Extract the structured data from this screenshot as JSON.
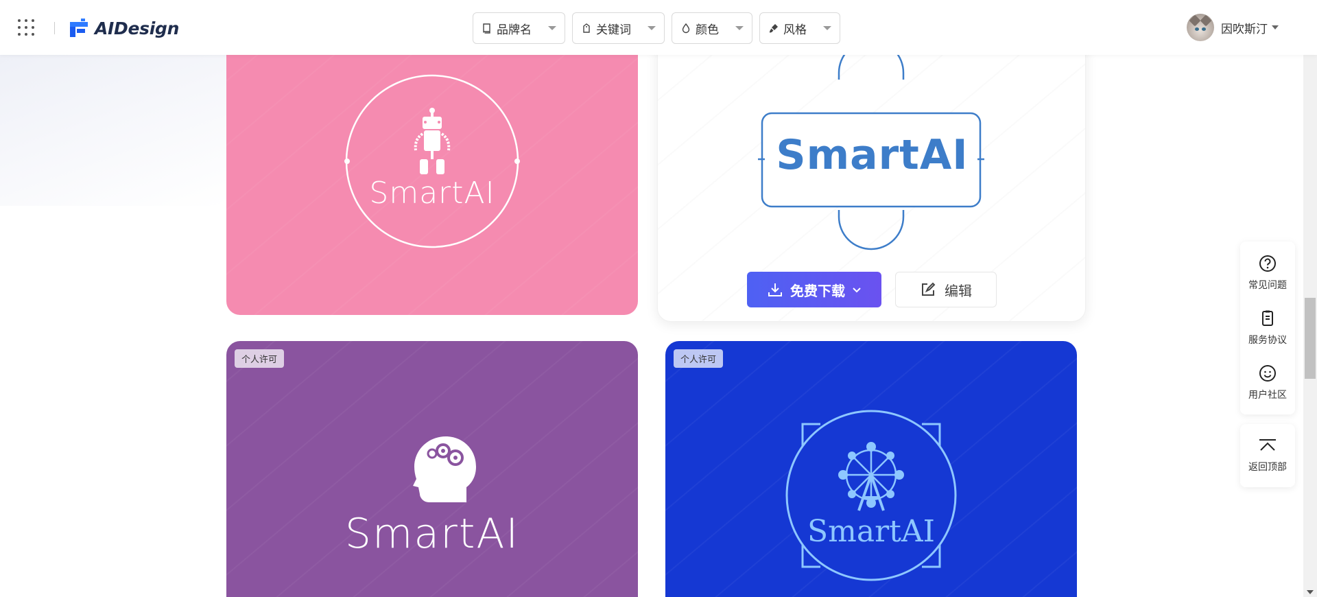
{
  "header": {
    "brand": "AIDesign",
    "filters": [
      {
        "label": "品牌名",
        "icon": "book-icon"
      },
      {
        "label": "关键词",
        "icon": "tag-icon"
      },
      {
        "label": "颜色",
        "icon": "drop-icon"
      },
      {
        "label": "风格",
        "icon": "brush-icon"
      }
    ],
    "user": {
      "name": "因吹斯汀"
    }
  },
  "cards": [
    {
      "logo_text": "SmartAI",
      "background": "#f58bb0",
      "icon": "robot-icon"
    },
    {
      "logo_text": "SmartAI",
      "background": "#ffffff",
      "accent": "#3d7dc9",
      "icon": "badge-frame-icon",
      "download_label": "免费下载",
      "edit_label": "编辑"
    },
    {
      "logo_text": "SmartAI",
      "background": "#8a549f",
      "icon": "brain-gears-icon",
      "badge": "个人许可"
    },
    {
      "logo_text": "SmartAI",
      "background": "#1538d3",
      "accent": "#8ec7ff",
      "icon": "ferris-wheel-icon",
      "badge": "个人许可"
    }
  ],
  "side_tools": {
    "items": [
      {
        "label": "常见问题",
        "icon": "question-icon"
      },
      {
        "label": "服务协议",
        "icon": "document-icon"
      },
      {
        "label": "用户社区",
        "icon": "smile-icon"
      }
    ],
    "back_to_top": {
      "label": "返回顶部",
      "icon": "arrow-top-icon"
    }
  }
}
